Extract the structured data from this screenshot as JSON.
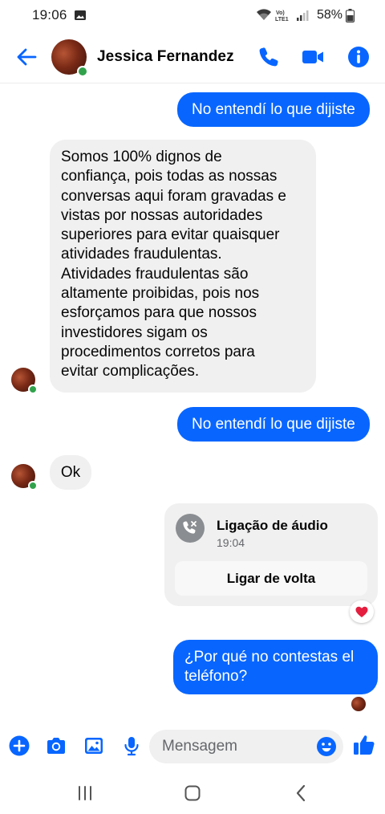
{
  "status_bar": {
    "time": "19:06",
    "network": "VoLTE1",
    "battery": "58%"
  },
  "header": {
    "contact_name": "Jessica Fernandez",
    "icons": [
      "back-arrow-icon",
      "phone-icon",
      "video-camera-icon",
      "info-icon"
    ]
  },
  "messages": [
    {
      "id": "m1",
      "direction": "outgoing",
      "text": "No entendí lo que dijiste"
    },
    {
      "id": "m2",
      "direction": "incoming",
      "lines": [
        "Somos 100% dignos de",
        "confiança, pois todas as nossas",
        "conversas aqui foram gravadas e",
        "vistas por nossas autoridades",
        "superiores para evitar quaisquer",
        "atividades fraudulentas.",
        "Atividades fraudulentas são",
        "altamente proibidas, pois nos",
        "esforçamos para que nossos",
        "investidores sigam os",
        "procedimentos corretos para",
        "evitar complicações."
      ]
    },
    {
      "id": "m3",
      "direction": "outgoing",
      "text": "No entendí lo que dijiste"
    },
    {
      "id": "m4",
      "direction": "incoming",
      "text": "Ok"
    },
    {
      "id": "m5",
      "direction": "incoming",
      "type": "call",
      "title": "Ligação de áudio",
      "time": "19:04",
      "action": "Ligar de volta",
      "reaction": "heart"
    },
    {
      "id": "m6",
      "direction": "outgoing",
      "lines": [
        "¿Por qué no contestas el",
        "teléfono?"
      ]
    }
  ],
  "composer": {
    "placeholder": "Mensagem",
    "icons": [
      "plus-icon",
      "camera-icon",
      "image-icon",
      "microphone-icon",
      "emoji-icon",
      "thumbs-up-icon"
    ]
  },
  "colors": {
    "accent": "#0866ff",
    "online": "#31a24c",
    "incoming_bubble": "#f0f0f0",
    "reaction": "#e41e3f"
  }
}
